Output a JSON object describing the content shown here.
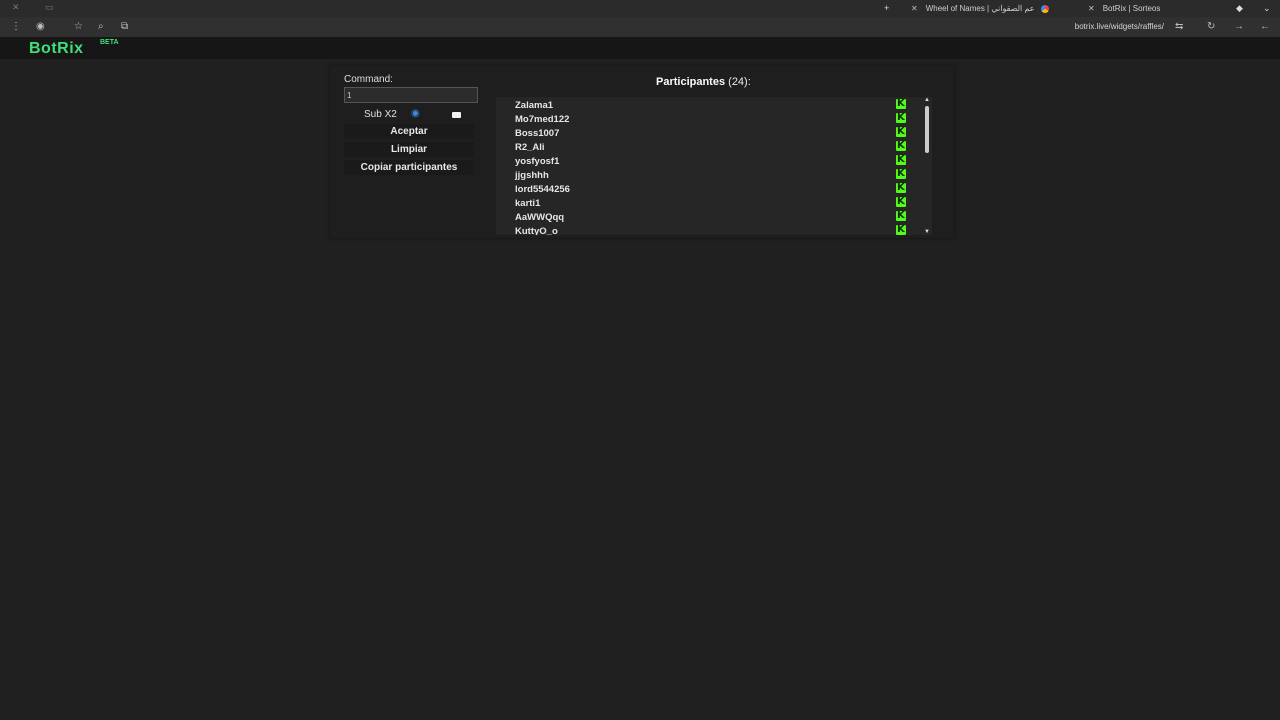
{
  "browser": {
    "tabs": [
      {
        "title": "Wheel of Names | عم الصقواني"
      },
      {
        "title": "BotRix | Sorteos"
      }
    ],
    "url": "botrix.live/widgets/raffles/"
  },
  "app": {
    "logo": "BotRix",
    "logo_badge": "BETA"
  },
  "controls": {
    "command_label": "Command:",
    "command_value": "1",
    "sub_label": "Sub X2",
    "sub_checked": true,
    "accept_label": "Aceptar",
    "clear_label": "Limpiar",
    "copy_label": "Copiar participantes"
  },
  "participants": {
    "title": "Participantes",
    "count": "(24):",
    "platform_icon": "kick-icon",
    "items": [
      {
        "name": "Zalama1"
      },
      {
        "name": "Mo7med122"
      },
      {
        "name": "Boss1007"
      },
      {
        "name": "R2_Ali"
      },
      {
        "name": "yosfyosf1"
      },
      {
        "name": "jjgshhh"
      },
      {
        "name": "lord5544256"
      },
      {
        "name": "karti1"
      },
      {
        "name": "AaWWQqq"
      },
      {
        "name": "KuttyO_o"
      }
    ]
  },
  "colors": {
    "background": "#202020",
    "accent": "#3fe07a",
    "kick_green": "#53fc18"
  }
}
